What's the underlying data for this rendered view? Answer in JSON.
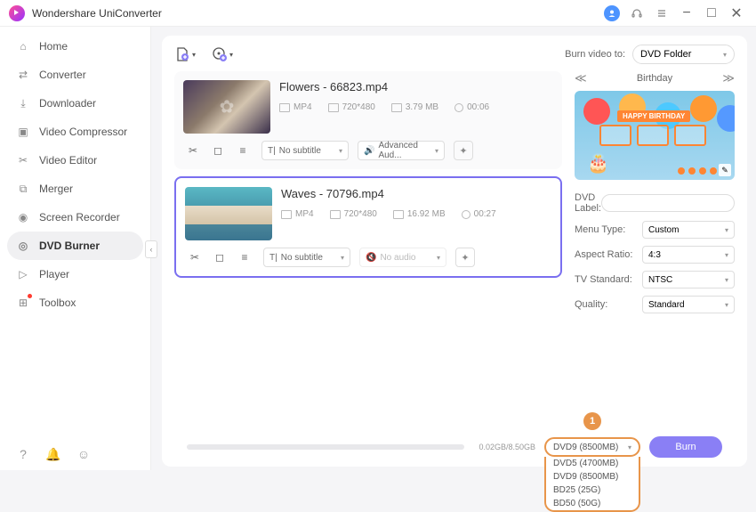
{
  "app": {
    "title": "Wondershare UniConverter"
  },
  "sidebar": {
    "items": [
      {
        "label": "Home"
      },
      {
        "label": "Converter"
      },
      {
        "label": "Downloader"
      },
      {
        "label": "Video Compressor"
      },
      {
        "label": "Video Editor"
      },
      {
        "label": "Merger"
      },
      {
        "label": "Screen Recorder"
      },
      {
        "label": "DVD Burner"
      },
      {
        "label": "Player"
      },
      {
        "label": "Toolbox"
      }
    ]
  },
  "toolbar": {
    "burn_to_label": "Burn video to:",
    "burn_to_value": "DVD Folder"
  },
  "files": [
    {
      "name": "Flowers - 66823.mp4",
      "format": "MP4",
      "resolution": "720*480",
      "size": "3.79 MB",
      "duration": "00:06",
      "subtitle": "No subtitle",
      "audio": "Advanced Aud..."
    },
    {
      "name": "Waves - 70796.mp4",
      "format": "MP4",
      "resolution": "720*480",
      "size": "16.92 MB",
      "duration": "00:27",
      "subtitle": "No subtitle",
      "audio": "No audio"
    }
  ],
  "theme": {
    "name": "Birthday",
    "banner": "HAPPY BIRTHDAY"
  },
  "settings": {
    "dvd_label_key": "DVD Label:",
    "dvd_label_value": "",
    "menu_type_key": "Menu Type:",
    "menu_type_value": "Custom",
    "aspect_key": "Aspect Ratio:",
    "aspect_value": "4:3",
    "tv_key": "TV Standard:",
    "tv_value": "NTSC",
    "quality_key": "Quality:",
    "quality_value": "Standard"
  },
  "bottom": {
    "size_text": "0.02GB/8.50GB",
    "disc_selected": "DVD9 (8500MB)",
    "disc_options": [
      "DVD5 (4700MB)",
      "DVD9 (8500MB)",
      "BD25 (25G)",
      "BD50 (50G)"
    ],
    "burn_label": "Burn",
    "callout": "1"
  }
}
